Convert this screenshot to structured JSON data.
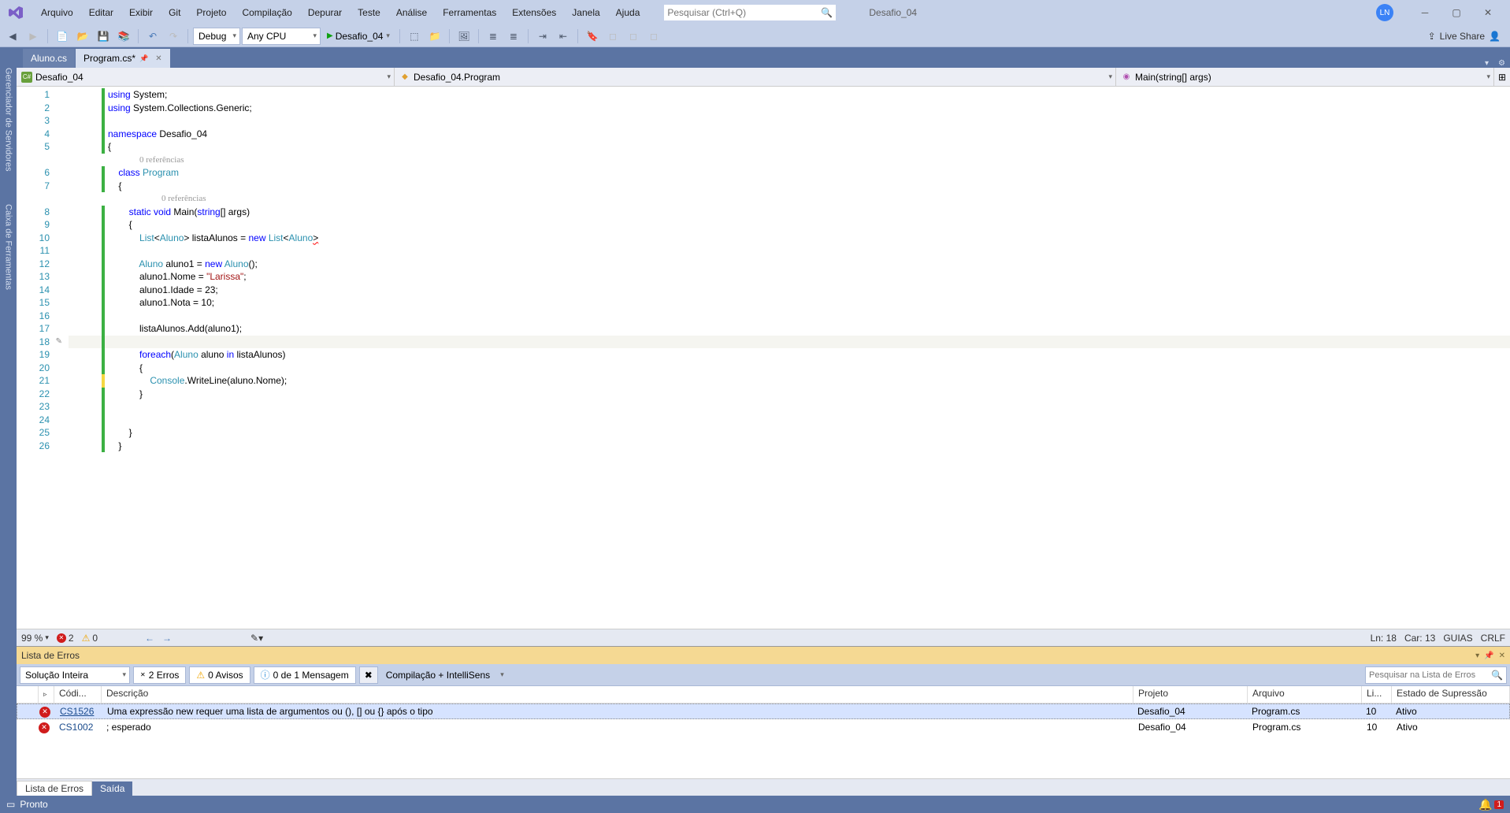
{
  "menu": {
    "items": [
      "Arquivo",
      "Editar",
      "Exibir",
      "Git",
      "Projeto",
      "Compilação",
      "Depurar",
      "Teste",
      "Análise",
      "Ferramentas",
      "Extensões",
      "Janela",
      "Ajuda"
    ]
  },
  "search": {
    "placeholder": "Pesquisar (Ctrl+Q)"
  },
  "solution_name": "Desafio_04",
  "user_initials": "LN",
  "toolbar": {
    "config": "Debug",
    "platform": "Any CPU",
    "run_target": "Desafio_04",
    "liveshare": "Live Share"
  },
  "side_tabs": [
    "Gerenciador de Servidores",
    "Caixa de Ferramentas"
  ],
  "tabs": [
    {
      "label": "Aluno.cs",
      "active": false
    },
    {
      "label": "Program.cs*",
      "active": true,
      "pinned": true
    }
  ],
  "nav": {
    "project": "Desafio_04",
    "type": "Desafio_04.Program",
    "member": "Main(string[] args)"
  },
  "codelens": "0 referências",
  "code_lines": [
    {
      "n": 1,
      "bar": "g",
      "html": "<span class='kblue'>using</span> System;"
    },
    {
      "n": 2,
      "bar": "g",
      "html": "<span class='kblue'>using</span> System.Collections.Generic;"
    },
    {
      "n": 3,
      "bar": "g",
      "html": ""
    },
    {
      "n": 4,
      "bar": "g",
      "html": "<span class='kblue'>namespace</span> Desafio_04"
    },
    {
      "n": 5,
      "bar": "g",
      "html": "{"
    },
    {
      "ref": true,
      "html": "0 referências"
    },
    {
      "n": 6,
      "bar": "g",
      "html": "    <span class='kblue'>class</span> <span class='kcls'>Program</span>"
    },
    {
      "n": 7,
      "bar": "g",
      "html": "    {"
    },
    {
      "ref": true,
      "html": "0 referências"
    },
    {
      "n": 8,
      "bar": "g",
      "html": "        <span class='kblue'>static</span> <span class='kblue'>void</span> Main(<span class='kblue'>string</span>[] args)"
    },
    {
      "n": 9,
      "bar": "g",
      "html": "        {"
    },
    {
      "n": 10,
      "bar": "g",
      "html": "            <span class='kcls'>List</span>&lt;<span class='kcls'>Aluno</span>&gt; listaAlunos = <span class='kblue'>new</span> <span class='kcls'>List</span>&lt;<span class='kcls'>Aluno</span><span class='err-squig'>&gt;</span>"
    },
    {
      "n": 11,
      "bar": "g",
      "html": ""
    },
    {
      "n": 12,
      "bar": "g",
      "html": "            <span class='kcls'>Aluno</span> aluno1 = <span class='kblue'>new</span> <span class='kcls'>Aluno</span>();"
    },
    {
      "n": 13,
      "bar": "g",
      "html": "            aluno1.Nome = <span class='kstr'>\"Larissa\"</span>;"
    },
    {
      "n": 14,
      "bar": "g",
      "html": "            aluno1.Idade = 23;"
    },
    {
      "n": 15,
      "bar": "g",
      "html": "            aluno1.Nota = 10;"
    },
    {
      "n": 16,
      "bar": "g",
      "html": ""
    },
    {
      "n": 17,
      "bar": "g",
      "html": "            listaAlunos.Add(aluno1);"
    },
    {
      "n": 18,
      "bar": "g",
      "cursor": true,
      "html": ""
    },
    {
      "n": 19,
      "bar": "g",
      "html": "            <span class='kblue'>foreach</span>(<span class='kcls'>Aluno</span> aluno <span class='kblue'>in</span> listaAlunos)"
    },
    {
      "n": 20,
      "bar": "g",
      "html": "            {"
    },
    {
      "n": 21,
      "bar": "y",
      "html": "                <span class='kcls'>Console</span>.WriteLine(aluno.Nome);"
    },
    {
      "n": 22,
      "bar": "g",
      "html": "            }"
    },
    {
      "n": 23,
      "bar": "g",
      "html": ""
    },
    {
      "n": 24,
      "bar": "g",
      "html": ""
    },
    {
      "n": 25,
      "bar": "g",
      "html": "        }"
    },
    {
      "n": 26,
      "bar": "g",
      "html": "    }"
    }
  ],
  "editor_status": {
    "zoom": "99 %",
    "errors": "2",
    "warnings": "0",
    "line": "Ln: 18",
    "col": "Car: 13",
    "indent": "GUIAS",
    "eol": "CRLF"
  },
  "error_panel": {
    "title": "Lista de Erros",
    "scope": "Solução Inteira",
    "errors_btn": "2 Erros",
    "warnings_btn": "0 Avisos",
    "messages_btn": "0 de 1 Mensagem",
    "build_filter": "Compilação + IntelliSens",
    "search_placeholder": "Pesquisar na Lista de Erros",
    "columns": {
      "code": "Códi...",
      "desc": "Descrição",
      "proj": "Projeto",
      "file": "Arquivo",
      "line": "Li...",
      "state": "Estado de Supressão"
    },
    "rows": [
      {
        "code": "CS1526",
        "desc": "Uma expressão new requer uma lista de argumentos ou (), [] ou {} após o tipo",
        "proj": "Desafio_04",
        "file": "Program.cs",
        "line": "10",
        "state": "Ativo",
        "selected": true
      },
      {
        "code": "CS1002",
        "desc": "; esperado",
        "proj": "Desafio_04",
        "file": "Program.cs",
        "line": "10",
        "state": "Ativo",
        "selected": false
      }
    ]
  },
  "bottom_tabs": {
    "active": "Lista de Erros",
    "inactive": "Saída"
  },
  "statusbar": {
    "text": "Pronto",
    "notif_count": "1"
  }
}
